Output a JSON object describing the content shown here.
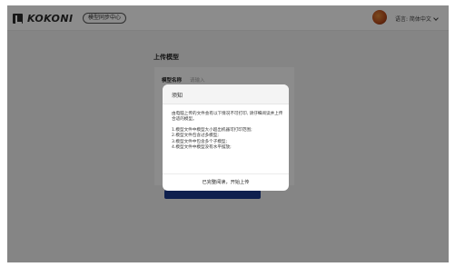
{
  "header": {
    "logo_text": "KOKONI",
    "tag_label": "模型同步中心",
    "language_label": "语言: 简体中文"
  },
  "form": {
    "page_title": "上传模型",
    "name_label": "模型名称",
    "name_placeholder": "请输入"
  },
  "modal": {
    "title": "须知",
    "intro": "由电脑上传的文件会有以下情况不可打印, 请仔细阅读并上传合适的模型。",
    "reasons": [
      "1.模型文件中模型大小超出机器可打印范围;",
      "2.模型文件包含过多模型;",
      "3.模型文件中包含多个子模型;",
      "4.模型文件中模型没有水平摆放;"
    ],
    "confirm_label": "已完整阅读，开始上传"
  },
  "colors": {
    "overlay": "rgba(0,0,0,0.45)",
    "submit_bar": "#1d3b8f"
  },
  "icons": [
    "logo-icon",
    "avatar",
    "chevron-down-icon"
  ]
}
